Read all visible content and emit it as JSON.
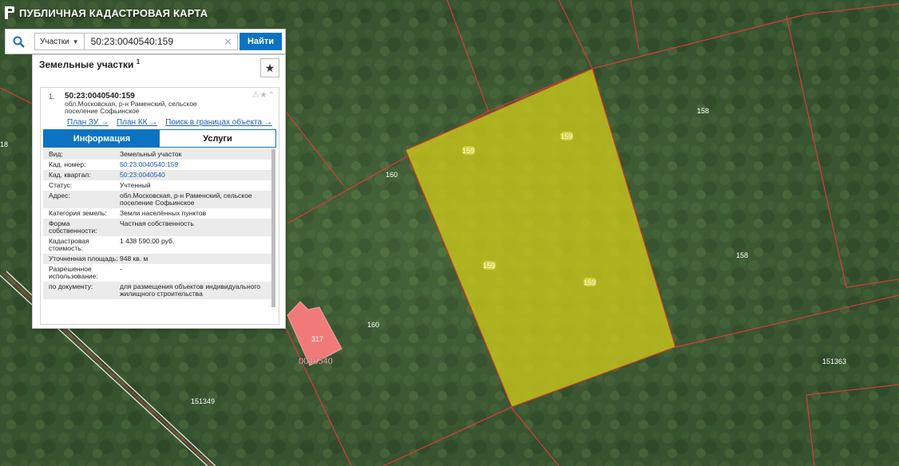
{
  "app": {
    "title": "ПУБЛИЧНАЯ КАДАСТРОВАЯ КАРТА"
  },
  "search": {
    "type_label": "Участки",
    "query": "50:23:0040540:159",
    "button_label": "Найти"
  },
  "panel": {
    "header": "Земельные участки",
    "header_count": "1",
    "result": {
      "number": "1.",
      "title": "50:23:0040540:159",
      "address": "обл.Московская, р-н Раменский, сельское поселение Софьинское",
      "links": [
        {
          "label": "План ЗУ →"
        },
        {
          "label": "План КК →"
        },
        {
          "label": "Поиск в границах объекта →"
        }
      ],
      "tabs": [
        {
          "label": "Информация"
        },
        {
          "label": "Услуги"
        }
      ],
      "info": [
        {
          "key": "Вид:",
          "value": "Земельный участок"
        },
        {
          "key": "Кад. номер:",
          "value": "50:23:0040540:159"
        },
        {
          "key": "Кад. квартал:",
          "value": "50:23:0040540"
        },
        {
          "key": "Статус:",
          "value": "Учтенный"
        },
        {
          "key": "Адрес:",
          "value": "обл.Московская, р-н Раменский, сельское поселение Софьинское"
        },
        {
          "key": "Категория земель:",
          "value": "Земли населённых пунктов"
        },
        {
          "key": "Форма собственности:",
          "value": "Частная собственность"
        },
        {
          "key": "Кадастровая стоимость:",
          "value": "1 438 590,00 руб."
        },
        {
          "key": "Уточненная площадь:",
          "value": "948 кв. м"
        },
        {
          "key": "Разрешенное использование:",
          "value": "-"
        },
        {
          "key": "по документу:",
          "value": "для размещения объектов индивидуального жилищного строительства"
        }
      ]
    }
  },
  "map": {
    "labels": [
      "159",
      "159",
      "159",
      "159",
      "160",
      "160",
      "158",
      "158",
      "151363",
      "151349",
      "18",
      "317",
      "0040540"
    ],
    "colors": {
      "parcel_fill": "#c7c41b",
      "boundary": "#d43c3c",
      "building": "#f07a7a"
    }
  }
}
